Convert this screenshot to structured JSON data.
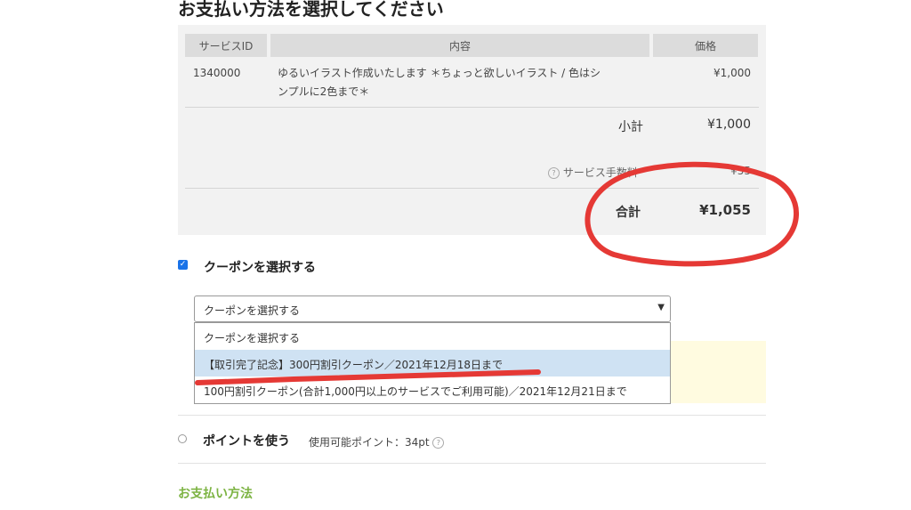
{
  "page": {
    "title": "お支払い方法を選択してください"
  },
  "order_table": {
    "headers": {
      "service_id": "サービスID",
      "content": "内容",
      "price": "価格"
    },
    "rows": [
      {
        "service_id": "1340000",
        "content": "ゆるいイラスト作成いたします ＊ちょっと欲しいイラスト / 色はシ",
        "content_line2": "ンプルに2色まで＊",
        "price": "¥1,000"
      }
    ]
  },
  "summary": {
    "subtotal_label": "小計",
    "subtotal_value": "¥1,000",
    "fee_label": "サービス手数料",
    "fee_value": "¥55",
    "total_label": "合計",
    "total_value": "¥1,055"
  },
  "coupon": {
    "checkbox_label": "クーポンを選択する",
    "checked": true,
    "select_value": "クーポンを選択する",
    "options": [
      "クーポンを選択する",
      "【取引完了記念】300円割引クーポン／2021年12月18日まで",
      "100円割引クーポン(合計1,000円以上のサービスでご利用可能)／2021年12月21日まで"
    ],
    "highlighted_index": 1
  },
  "points": {
    "label": "ポイントを使う",
    "available_label": "使用可能ポイント：34pt"
  },
  "payment": {
    "section_label": "お支払い方法"
  },
  "icons": {
    "help": "question-circle-icon",
    "chevron": "chevron-down-icon",
    "check": "check-icon"
  },
  "colors": {
    "accent": "#1a73e8",
    "green": "#7cb342",
    "annotation": "#e53935",
    "highlight": "#cfe2f3"
  }
}
